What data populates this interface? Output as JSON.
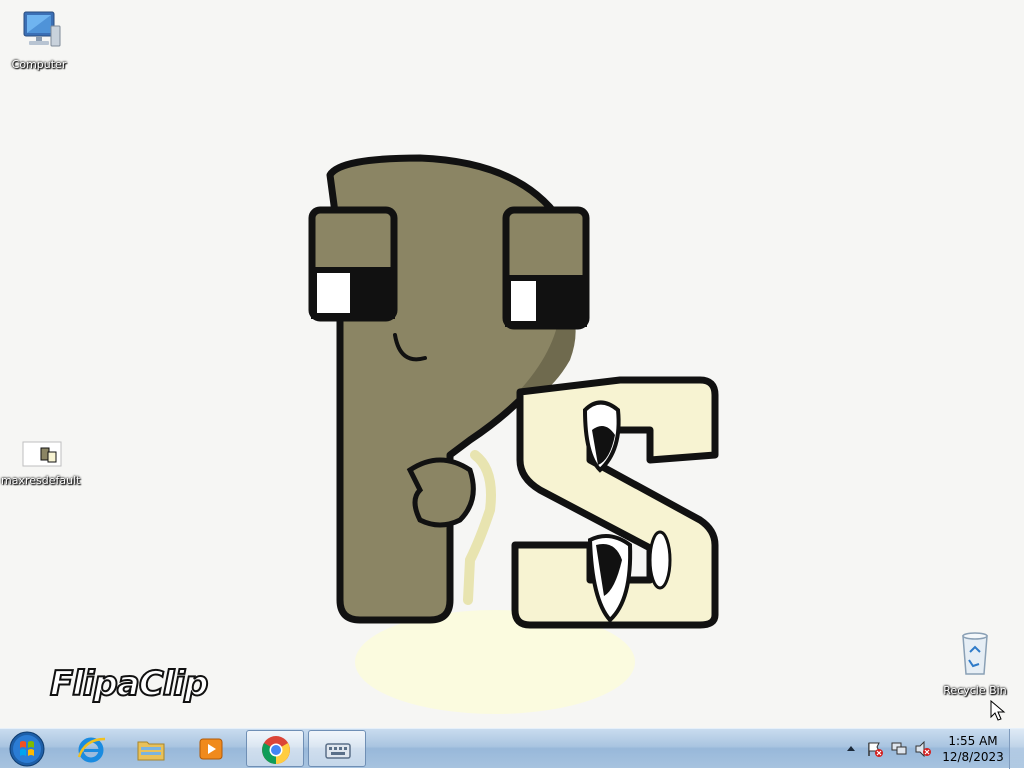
{
  "desktop": {
    "icons": [
      {
        "label": "Computer"
      },
      {
        "label": "maxresdefault"
      },
      {
        "label": "Recycle Bin"
      }
    ],
    "watermark": "FlipaClip"
  },
  "taskbar": {
    "pinned": [
      {
        "icon": "internet-explorer-icon"
      },
      {
        "icon": "windows-explorer-icon"
      },
      {
        "icon": "media-player-icon"
      },
      {
        "icon": "chrome-icon"
      },
      {
        "icon": "on-screen-keyboard-icon"
      }
    ],
    "clock": {
      "time": "1:55 AM",
      "date": "12/8/2023"
    }
  },
  "colors": {
    "accent_letter": "#8b8564",
    "accent_letter_light": "#f7f3d2"
  }
}
